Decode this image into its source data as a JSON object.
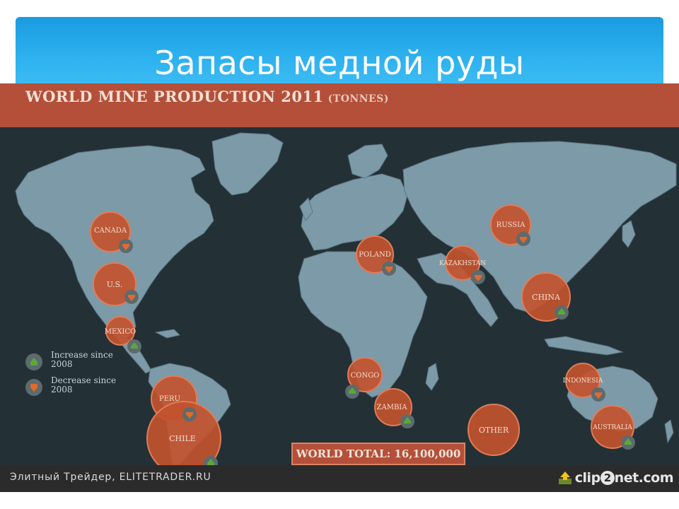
{
  "slide": {
    "title": "Запасы медной руды"
  },
  "infographic": {
    "heading": "WORLD MINE PRODUCTION 2011",
    "heading_unit": "(TONNES)",
    "world_total": "WORLD TOTAL: 16,100,000",
    "legend": [
      {
        "label": "Increase since 2008",
        "trend": "increase",
        "color": "#5aa83a"
      },
      {
        "label": "Decrease since 2008",
        "trend": "decrease",
        "color": "#e06a2c"
      }
    ],
    "countries": [
      {
        "label": "CANADA",
        "trend": "decrease"
      },
      {
        "label": "U.S.",
        "trend": "decrease"
      },
      {
        "label": "MEXICO",
        "trend": "increase"
      },
      {
        "label": "PERU",
        "trend": "decrease"
      },
      {
        "label": "CHILE",
        "trend": "increase"
      },
      {
        "label": "POLAND",
        "trend": "decrease"
      },
      {
        "label": "RUSSIA",
        "trend": "decrease"
      },
      {
        "label": "KAZAKHSTAN",
        "trend": "decrease"
      },
      {
        "label": "CHINA",
        "trend": "increase"
      },
      {
        "label": "CONGO",
        "trend": "increase"
      },
      {
        "label": "ZAMBIA",
        "trend": "increase"
      },
      {
        "label": "INDONESIA",
        "trend": "decrease"
      },
      {
        "label": "AUSTRALIA",
        "trend": "increase"
      },
      {
        "label": "OTHER",
        "trend": null
      }
    ],
    "colors": {
      "ocean": "#233136",
      "land": "#7d9aa8",
      "bubble": "#c2532f",
      "header": "#b4503a",
      "increase": "#5aa83a",
      "decrease": "#e06a2c"
    }
  },
  "footer": {
    "source": "Элитный Трейдер, ELITETRADER.RU",
    "logo_pre": "clip",
    "logo_num": "2",
    "logo_post": "net.com"
  }
}
